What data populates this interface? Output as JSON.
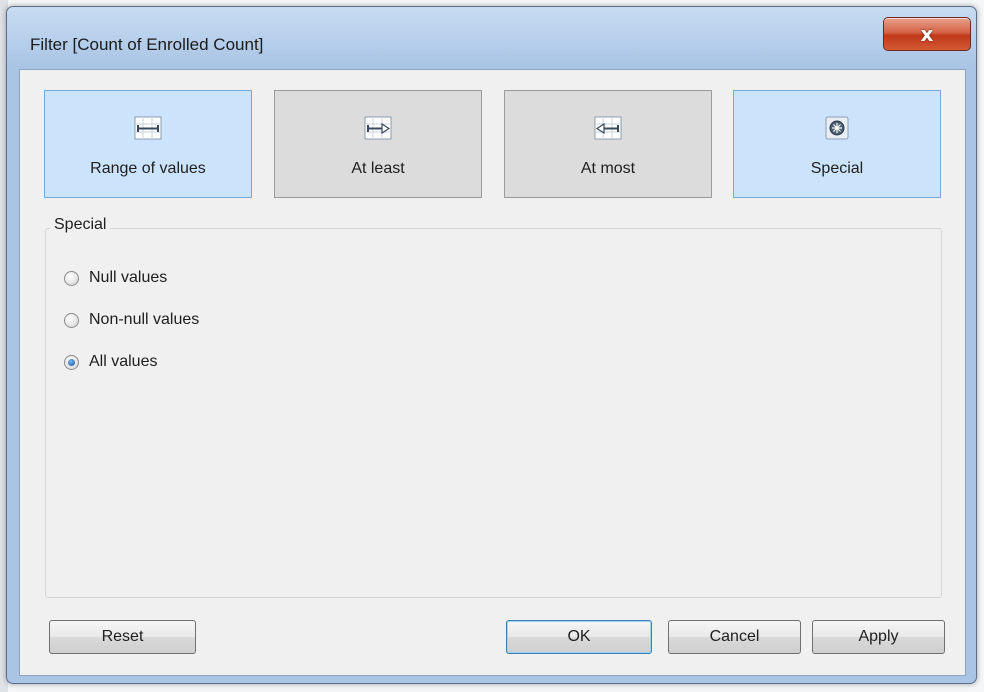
{
  "dialog": {
    "title": "Filter [Count of Enrolled Count]",
    "close_label": "x"
  },
  "modes": [
    {
      "label": "Range of values",
      "icon": "range-of-values-icon",
      "active": true
    },
    {
      "label": "At least",
      "icon": "at-least-icon",
      "active": false
    },
    {
      "label": "At most",
      "icon": "at-most-icon",
      "active": false
    },
    {
      "label": "Special",
      "icon": "special-icon",
      "active": true
    }
  ],
  "special": {
    "group_label": "Special",
    "options": [
      {
        "label": "Null values",
        "selected": false
      },
      {
        "label": "Non-null values",
        "selected": false
      },
      {
        "label": "All values",
        "selected": true
      }
    ]
  },
  "buttons": {
    "reset": "Reset",
    "ok": "OK",
    "cancel": "Cancel",
    "apply": "Apply"
  },
  "colors": {
    "active_mode": "#cce4fb",
    "inactive_mode": "#dcdcdc",
    "close_button": "#c1391a"
  }
}
